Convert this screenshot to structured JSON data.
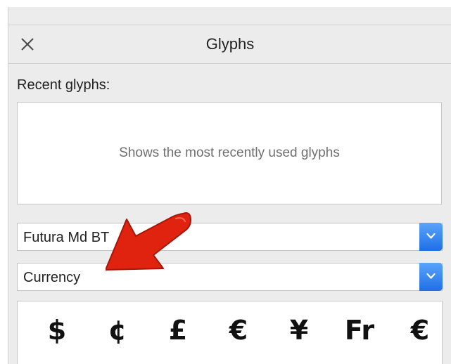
{
  "panel": {
    "title": "Glyphs",
    "close_icon": "close-icon"
  },
  "recent": {
    "label": "Recent glyphs:",
    "hint": "Shows the most recently used glyphs"
  },
  "font_select": {
    "value": "Futura Md BT",
    "icon": "chevron-down-icon"
  },
  "category_select": {
    "value": "Currency",
    "icon": "chevron-down-icon"
  },
  "glyphs": [
    "$",
    "¢",
    "£",
    "€",
    "¥",
    "Fr",
    "€"
  ],
  "annotation": {
    "icon": "red-arrow",
    "color": "#e0230f"
  },
  "colors": {
    "accent": "#2b7cf0",
    "panel_bg": "#ececec"
  }
}
